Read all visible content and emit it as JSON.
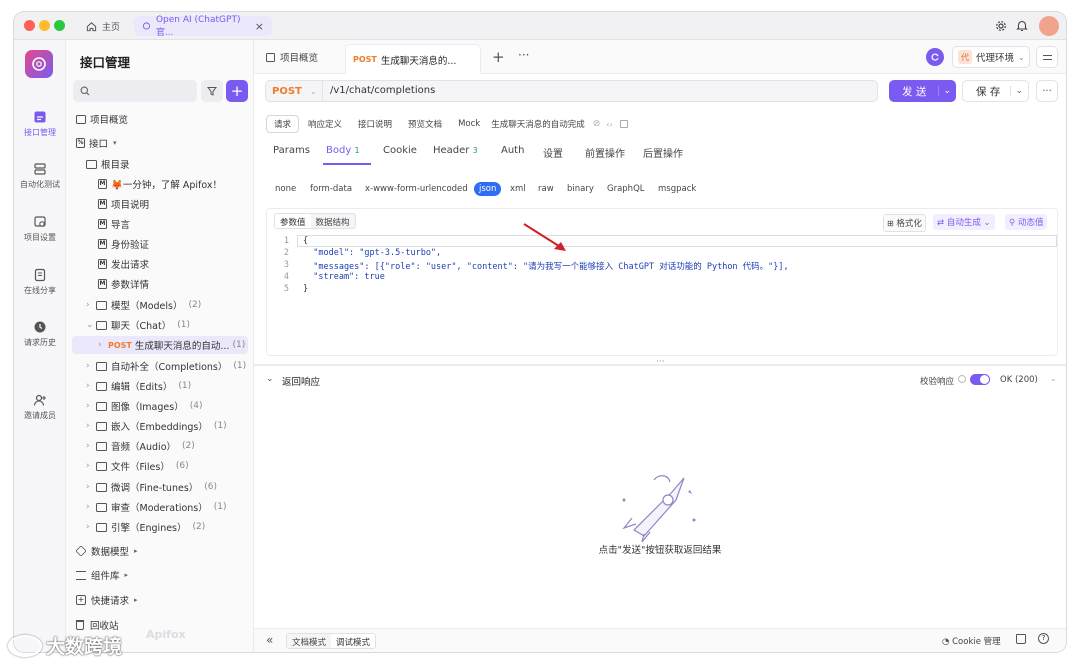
{
  "titlebar": {
    "home_label": "主页",
    "tab_label": "Open AI (ChatGPT) 官...",
    "close_glyph": "×"
  },
  "rail": {
    "items": [
      {
        "label": "接口管理",
        "active": true
      },
      {
        "label": "自动化测试"
      },
      {
        "label": "项目设置"
      },
      {
        "label": "在线分享"
      },
      {
        "label": "请求历史"
      },
      {
        "label": "邀请成员"
      }
    ]
  },
  "tree": {
    "title": "接口管理",
    "search_placeholder": "",
    "items": [
      {
        "label": "项目概览",
        "type": "overview"
      },
      {
        "label": "接口",
        "type": "api-root"
      },
      {
        "label": "根目录",
        "type": "folder"
      },
      {
        "label": "🦊一分钟，了解 Apifox！",
        "type": "doc"
      },
      {
        "label": "项目说明",
        "type": "doc"
      },
      {
        "label": "导言",
        "type": "doc"
      },
      {
        "label": "身份验证",
        "type": "doc"
      },
      {
        "label": "发出请求",
        "type": "doc"
      },
      {
        "label": "参数详情",
        "type": "doc"
      },
      {
        "label": "模型（Models）",
        "count": "(2)",
        "type": "folder"
      },
      {
        "label": "聊天（Chat）",
        "count": "(1)",
        "type": "folder-open"
      },
      {
        "method": "POST",
        "label": "生成聊天消息的自动...",
        "count": "(1)",
        "type": "endpoint"
      },
      {
        "label": "自动补全（Completions）",
        "count": "(1)",
        "type": "folder"
      },
      {
        "label": "编辑（Edits）",
        "count": "(1)",
        "type": "folder"
      },
      {
        "label": "图像（Images）",
        "count": "(4)",
        "type": "folder"
      },
      {
        "label": "嵌入（Embeddings）",
        "count": "(1)",
        "type": "folder"
      },
      {
        "label": "音频（Audio）",
        "count": "(2)",
        "type": "folder"
      },
      {
        "label": "文件（Files）",
        "count": "(6)",
        "type": "folder"
      },
      {
        "label": "微调（Fine-tunes）",
        "count": "(6)",
        "type": "folder"
      },
      {
        "label": "审查（Moderations）",
        "count": "(1)",
        "type": "folder"
      },
      {
        "label": "引擎（Engines）",
        "count": "(2)",
        "type": "folder"
      }
    ],
    "sections": [
      {
        "label": "数据模型"
      },
      {
        "label": "组件库"
      },
      {
        "label": "快捷请求"
      },
      {
        "label": "回收站"
      }
    ],
    "watermark": "Apifox"
  },
  "tabs": {
    "overview": "项目概览",
    "active_method": "POST",
    "active_label": "生成聊天消息的...",
    "env_badge": "代",
    "env_label": "代理环境"
  },
  "request": {
    "method": "POST",
    "url": "/v1/chat/completions",
    "send_label": "发 送",
    "save_label": "保 存"
  },
  "subnav": {
    "items": [
      "请求",
      "响应定义",
      "接口说明",
      "预览文档",
      "Mock"
    ],
    "title": "生成聊天消息的自动完成"
  },
  "paramtabs": {
    "items": [
      "Params",
      "Body",
      "Cookie",
      "Header",
      "Auth",
      "设置",
      "前置操作",
      "后置操作"
    ],
    "body_count": "1",
    "header_count": "3"
  },
  "bodytypes": {
    "items": [
      "none",
      "form-data",
      "x-www-form-urlencoded",
      "json",
      "xml",
      "raw",
      "binary",
      "GraphQL",
      "msgpack"
    ],
    "selected": "json"
  },
  "editor": {
    "modes": [
      "参数值",
      "数据结构"
    ],
    "format_label": "格式化",
    "autogen_label": "自动生成",
    "dynamic_label": "动态值",
    "line_numbers": [
      "1",
      "2",
      "3",
      "4",
      "5"
    ],
    "lines": [
      "{",
      "  \"model\": \"gpt-3.5-turbo\",",
      "  \"messages\": [{\"role\": \"user\", \"content\": \"请为我写一个能够接入 ChatGPT 对话功能的 Python 代码。\"}],",
      "  \"stream\": true",
      "}"
    ]
  },
  "response": {
    "title": "返回响应",
    "validate_label": "校验响应",
    "status_label": "OK (200)",
    "empty_text": "点击\"发送\"按钮获取返回结果"
  },
  "footer": {
    "doc_mode": "文档模式",
    "debug_mode": "调试模式",
    "cookie_label": "Cookie 管理"
  },
  "watermark_text": "大数跨境",
  "colors": {
    "accent": "#7a5af0",
    "post": "#f07c2a",
    "json_chip": "#2f6ef0",
    "arrow": "#d0202a"
  }
}
